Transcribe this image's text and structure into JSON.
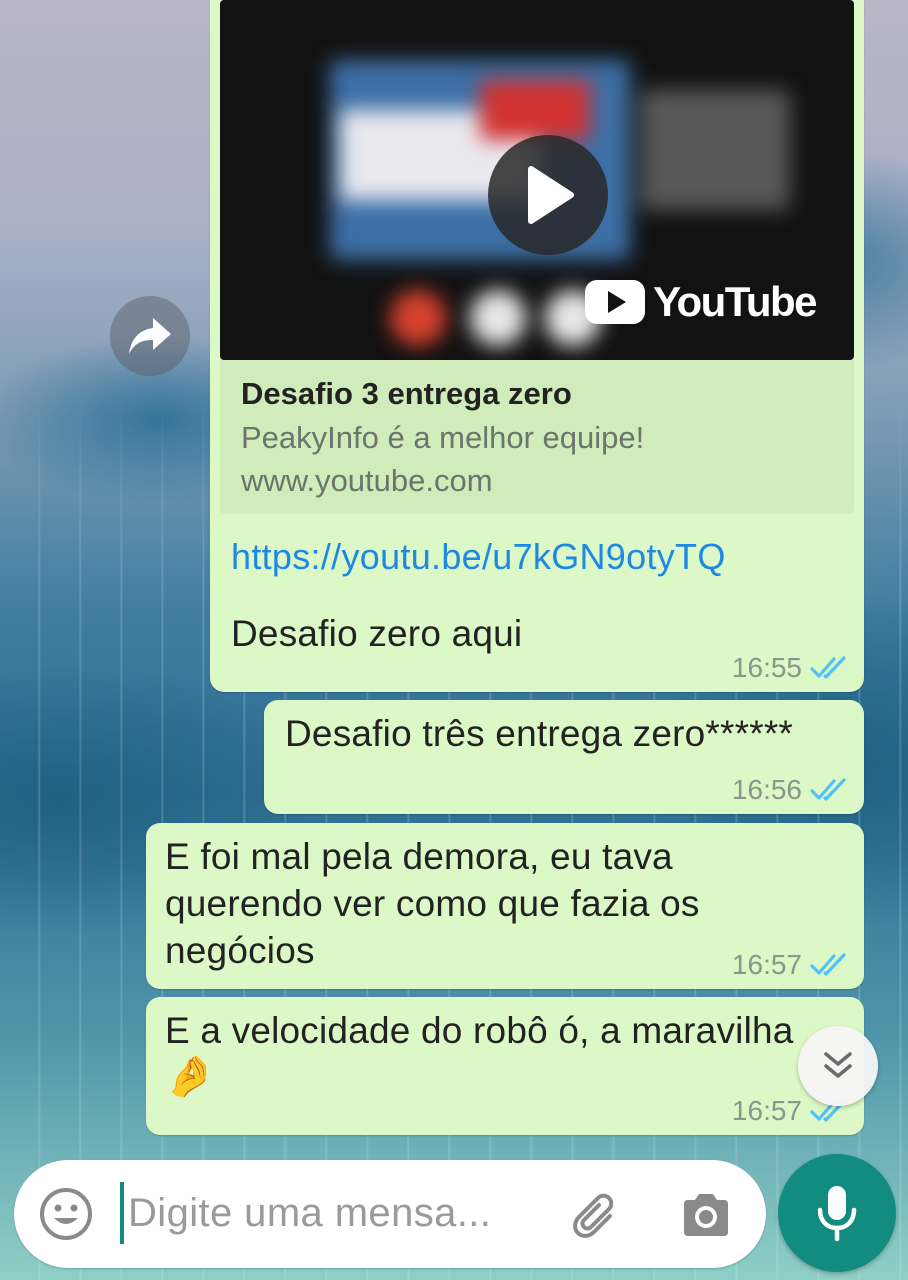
{
  "colors": {
    "bubble_outgoing": "#dcf8c6",
    "link_blue": "#1e88e5",
    "tick_blue": "#4fc3f7",
    "accent_teal": "#128c7e"
  },
  "messages": [
    {
      "type": "link_preview",
      "preview": {
        "brand": "YouTube",
        "title": "Desafio 3 entrega zero",
        "description": "PeakyInfo é a melhor equipe!",
        "domain": "www.youtube.com"
      },
      "url": "https://youtu.be/u7kGN9otyTQ",
      "text": "Desafio zero aqui",
      "time": "16:55",
      "status": "read"
    },
    {
      "type": "text",
      "text": "Desafio três entrega zero******",
      "time": "16:56",
      "status": "read"
    },
    {
      "type": "text",
      "lines": [
        "E foi mal pela demora, eu tava",
        "querendo ver como que fazia os",
        "negócios"
      ],
      "time": "16:57",
      "status": "read"
    },
    {
      "type": "text",
      "lines": [
        "E a velocidade do robô ó, a maravilha",
        "🤌"
      ],
      "time": "16:57",
      "status": "read"
    }
  ],
  "composer": {
    "placeholder": "Digite uma mensa..."
  },
  "icons": {
    "forward": "forward-icon",
    "play": "play-icon",
    "scroll_down": "double-chevron-down-icon",
    "emoji": "smiley-icon",
    "attach": "paperclip-icon",
    "camera": "camera-icon",
    "mic": "microphone-icon"
  }
}
